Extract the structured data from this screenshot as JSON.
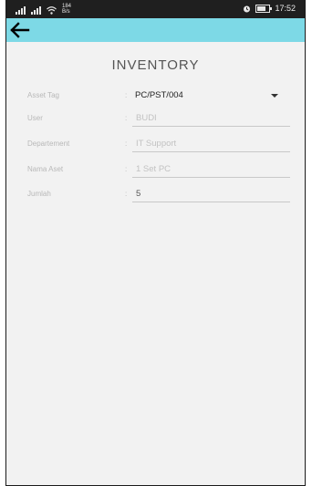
{
  "status_bar": {
    "network_speed_value": "184",
    "network_speed_unit": "B/s",
    "time": "17:52"
  },
  "app_bar": {
    "back_icon": "arrow-left-icon",
    "background": "#7dd9e6"
  },
  "page": {
    "title": "INVENTORY"
  },
  "form": {
    "separator": ":",
    "fields": [
      {
        "label": "Asset Tag",
        "value": "PC/PST/004",
        "type": "dropdown"
      },
      {
        "label": "User",
        "value": "BUDI",
        "type": "text"
      },
      {
        "label": "Departement",
        "value": "IT Support",
        "type": "text"
      },
      {
        "label": "Nama Aset",
        "value": "1 Set PC",
        "type": "text"
      },
      {
        "label": "Jumlah",
        "value": "5",
        "type": "text"
      }
    ]
  }
}
